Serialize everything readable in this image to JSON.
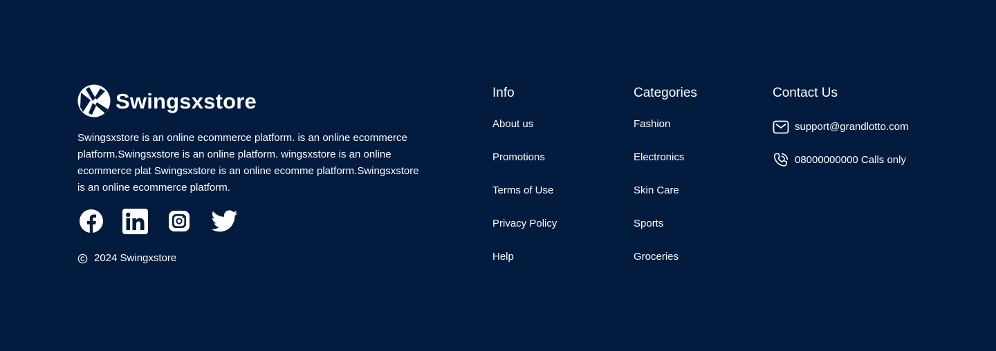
{
  "brand": {
    "name": "Swingsxstore",
    "description": "Swingsxstore is an online ecommerce platform. is an online ecommerce platform.Swingsxstore is an online  platform. wingsxstore is an online ecommerce plat Swingsxstore is an online ecomme platform.Swingsxstore is an online ecommerce platform.",
    "logo_icon": "swingsxstore-logo-icon"
  },
  "social": [
    {
      "name": "facebook",
      "icon": "facebook-icon"
    },
    {
      "name": "linkedin",
      "icon": "linkedin-icon"
    },
    {
      "name": "instagram",
      "icon": "instagram-icon"
    },
    {
      "name": "twitter",
      "icon": "twitter-icon"
    }
  ],
  "copyright": {
    "icon": "copyright-icon",
    "text": "2024 Swingxstore"
  },
  "info": {
    "title": "Info",
    "links": [
      "About us",
      "Promotions",
      "Terms of Use",
      "Privacy Policy",
      "Help"
    ]
  },
  "categories": {
    "title": "Categories",
    "links": [
      "Fashion",
      "Electronics",
      "Skin Care",
      "Sports",
      "Groceries"
    ]
  },
  "contact": {
    "title": "Contact Us",
    "email": "support@grandlotto.com",
    "email_icon": "mail-icon",
    "phone": "08000000000 Calls only",
    "phone_icon": "phone-icon"
  },
  "colors": {
    "background": "#021b3f",
    "text": "#ffffff"
  }
}
